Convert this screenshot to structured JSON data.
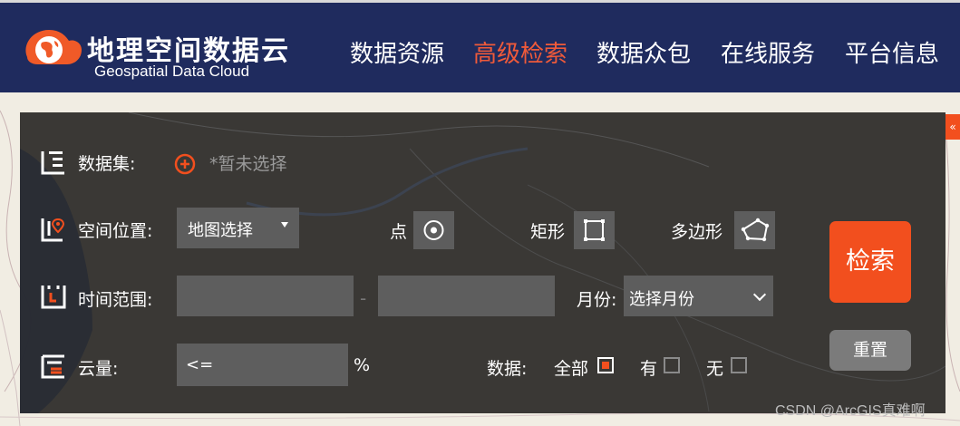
{
  "header": {
    "brand_cn": "地理空间数据云",
    "brand_en": "Geospatial Data Cloud",
    "nav": [
      {
        "label": "数据资源",
        "active": false
      },
      {
        "label": "高级检索",
        "active": true
      },
      {
        "label": "数据众包",
        "active": false
      },
      {
        "label": "在线服务",
        "active": false
      },
      {
        "label": "平台信息",
        "active": false
      }
    ]
  },
  "colors": {
    "header_bg": "#1f2b5e",
    "accent": "#f24f1e",
    "active_nav": "#ef5a3a",
    "panel_bg": "#2c2a28"
  },
  "search_panel": {
    "collapse_glyph": "«",
    "dataset": {
      "label": "数据集:",
      "placeholder": "*暂未选择",
      "icon": "plus-circle-icon"
    },
    "location": {
      "label": "空间位置:",
      "select_value": "地图选择",
      "point_label": "点",
      "rect_label": "矩形",
      "polygon_label": "多边形"
    },
    "time": {
      "label": "时间范围:",
      "separator": "-",
      "start_value": "",
      "end_value": "",
      "month_label": "月份:",
      "month_select_value": "选择月份"
    },
    "cloud": {
      "label": "云量:",
      "operator": "<=",
      "unit": "%",
      "data_label": "数据:",
      "options": [
        {
          "label": "全部",
          "checked": true
        },
        {
          "label": "有",
          "checked": false
        },
        {
          "label": "无",
          "checked": false
        }
      ]
    },
    "search_button": "检索",
    "reset_button": "重置"
  },
  "watermark": "CSDN @ArcGIS真难啊"
}
